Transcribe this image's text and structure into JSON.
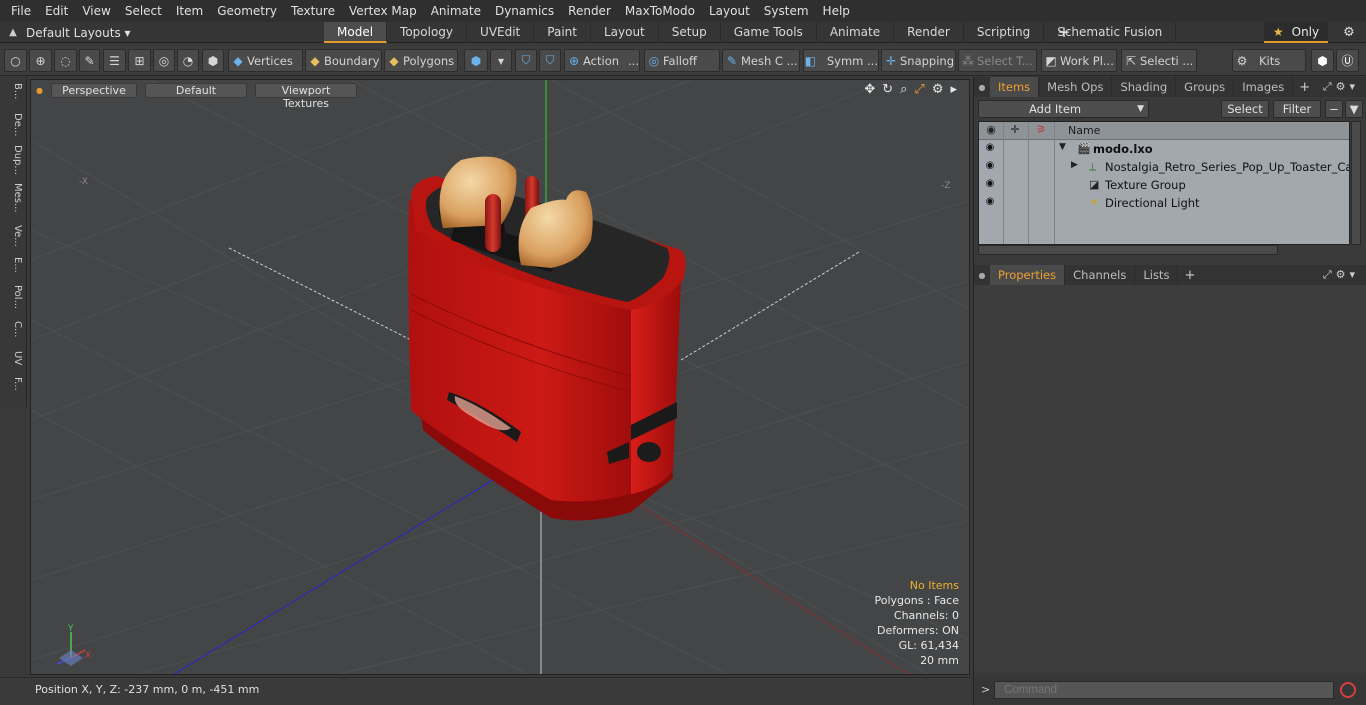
{
  "menu": [
    "File",
    "Edit",
    "View",
    "Select",
    "Item",
    "Geometry",
    "Texture",
    "Vertex Map",
    "Animate",
    "Dynamics",
    "Render",
    "MaxToModo",
    "Layout",
    "System",
    "Help"
  ],
  "layouts": {
    "label": "Default Layouts ▾"
  },
  "tabs": [
    "Model",
    "Topology",
    "UVEdit",
    "Paint",
    "Layout",
    "Setup",
    "Game Tools",
    "Animate",
    "Render",
    "Scripting",
    "Schematic Fusion"
  ],
  "active_tab": "Model",
  "only_label": "Only",
  "toolbar": {
    "vertices": "Vertices",
    "boundary": "Boundary",
    "polygons": "Polygons",
    "action": "Action",
    "action_more": "...",
    "falloff": "Falloff",
    "mesh": "Mesh C ...",
    "symm": "Symm ...",
    "snapping": "Snapping",
    "select_t": "Select T...",
    "work_pl": "Work Pl...",
    "selecti": "Selecti ...",
    "kits": "Kits"
  },
  "left_tabs": [
    "B...",
    "De...",
    "Dup...",
    "Mes...",
    "Ve...",
    "E...",
    "Pol...",
    "C...",
    "UV",
    "F..."
  ],
  "viewport": {
    "perspective": "Perspective",
    "shading": "Default",
    "textures": "Viewport Textures",
    "info": {
      "no_items": "No Items",
      "polygons": "Polygons : Face",
      "channels": "Channels: 0",
      "deformers": "Deformers: ON",
      "gl": "GL: 61,434",
      "scale": "20 mm"
    },
    "axis_labels": {
      "x": "X",
      "y": "Y",
      "z": "Z",
      "neg_x": "-X",
      "neg_z": "-Z"
    }
  },
  "status": {
    "position": "Position X, Y, Z:  -237 mm, 0 m, -451 mm"
  },
  "items_panel": {
    "tabs": [
      "Items",
      "Mesh Ops",
      "Shading",
      "Groups",
      "Images"
    ],
    "active": "Items",
    "add_item": "Add Item",
    "select": "Select",
    "filter": "Filter",
    "column_name": "Name",
    "rows": [
      {
        "label": "modo.lxo",
        "bold": true
      },
      {
        "label": "Nostalgia_Retro_Series_Pop_Up_Toaster_Carr ..."
      },
      {
        "label": "Texture Group"
      },
      {
        "label": "Directional Light"
      }
    ]
  },
  "props_panel": {
    "tabs": [
      "Properties",
      "Channels",
      "Lists"
    ],
    "active": "Properties"
  },
  "command": {
    "placeholder": "Command"
  },
  "colors": {
    "accent": "#e39a2a",
    "toaster": "#c01414",
    "viewport_bg": "#444546"
  }
}
